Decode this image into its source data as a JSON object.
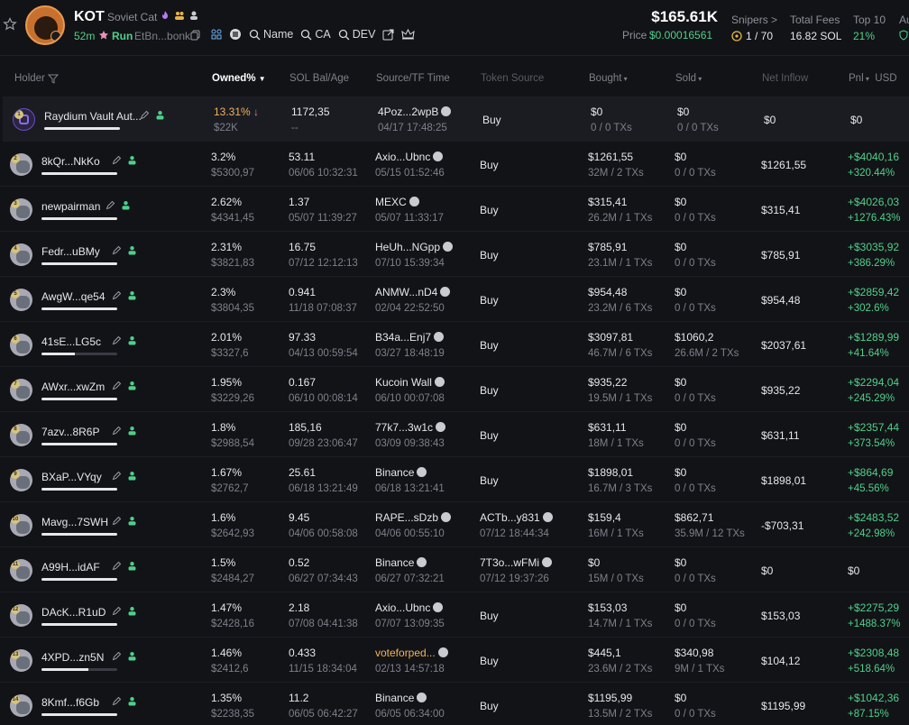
{
  "token": {
    "ticker": "KOT",
    "name": "Soviet Cat",
    "age": "52m",
    "status": "Run",
    "address": "EtBn...bonk"
  },
  "toolbar": {
    "name_label": "Name",
    "ca_label": "CA",
    "dev_label": "DEV"
  },
  "price": {
    "mcap": "$165.61K",
    "label": "Price",
    "value": "$0.00016561"
  },
  "stats": {
    "snipers_label": "Snipers >",
    "snipers_value": "1 / 70",
    "fees_label": "Total Fees",
    "fees_value": "16.82 SOL",
    "top10_label": "Top 10",
    "top10_value": "21%",
    "au_label": "Au"
  },
  "columns": {
    "holder": "Holder",
    "owned": "Owned%",
    "sol_bal": "SOL Bal/Age",
    "source": "Source/TF Time",
    "token_source": "Token Source",
    "bought": "Bought",
    "sold": "Sold",
    "net_inflow": "Net Inflow",
    "pnl": "Pnl",
    "currency": "USD"
  },
  "colors": {
    "green": "#4fd08a",
    "orange": "#f0b25a",
    "red": "#f07a8a",
    "bg": "#121317"
  },
  "rows": [
    {
      "rank": "1",
      "name": "Raydium Vault Aut...",
      "bar": 1.0,
      "owned": "13.31%",
      "owned_usd": "$22K",
      "sol": "1172,35",
      "age": "--",
      "source": "4Poz...2wpB",
      "source_time": "04/17 17:48:25",
      "tsrc": "Buy",
      "tsrc_time": "",
      "bought": "$0",
      "bought_tx": "0 / 0 TXs",
      "sold": "$0",
      "sold_tx": "0 / 0 TXs",
      "net": "$0",
      "pnl": "$0",
      "pnl_pct": ""
    },
    {
      "rank": "2",
      "name": "8kQr...NkKo",
      "bar": 1.0,
      "owned": "3.2%",
      "owned_usd": "$5300,97",
      "sol": "53.11",
      "age": "06/06 10:32:31",
      "source": "Axio...Ubnc",
      "source_time": "05/15 01:52:46",
      "tsrc": "Buy",
      "tsrc_time": "",
      "bought": "$1261,55",
      "bought_tx": "32M / 2 TXs",
      "sold": "$0",
      "sold_tx": "0 / 0 TXs",
      "net": "$1261,55",
      "pnl": "+$4040,16",
      "pnl_pct": "+320.44%"
    },
    {
      "rank": "3",
      "name": "newpairman",
      "bar": 1.0,
      "owned": "2.62%",
      "owned_usd": "$4341,45",
      "sol": "1.37",
      "age": "05/07 11:39:27",
      "source": "MEXC",
      "source_time": "05/07 11:33:17",
      "tsrc": "Buy",
      "tsrc_time": "",
      "bought": "$315,41",
      "bought_tx": "26.2M / 1 TXs",
      "sold": "$0",
      "sold_tx": "0 / 0 TXs",
      "net": "$315,41",
      "pnl": "+$4026,03",
      "pnl_pct": "+1276.43%"
    },
    {
      "rank": "4",
      "name": "Fedr...uBMy",
      "bar": 1.0,
      "owned": "2.31%",
      "owned_usd": "$3821,83",
      "sol": "16.75",
      "age": "07/12 12:12:13",
      "source": "HeUh...NGpp",
      "source_time": "07/10 15:39:34",
      "tsrc": "Buy",
      "tsrc_time": "",
      "bought": "$785,91",
      "bought_tx": "23.1M / 1 TXs",
      "sold": "$0",
      "sold_tx": "0 / 0 TXs",
      "net": "$785,91",
      "pnl": "+$3035,92",
      "pnl_pct": "+386.29%"
    },
    {
      "rank": "5",
      "name": "AwgW...qe54",
      "bar": 1.0,
      "owned": "2.3%",
      "owned_usd": "$3804,35",
      "sol": "0.941",
      "age": "11/18 07:08:37",
      "source": "ANMW...nD4",
      "source_time": "02/04 22:52:50",
      "tsrc": "Buy",
      "tsrc_time": "",
      "bought": "$954,48",
      "bought_tx": "23.2M / 6 TXs",
      "sold": "$0",
      "sold_tx": "0 / 0 TXs",
      "net": "$954,48",
      "pnl": "+$2859,42",
      "pnl_pct": "+302.6%"
    },
    {
      "rank": "6",
      "name": "41sE...LG5c",
      "bar": 0.44,
      "owned": "2.01%",
      "owned_usd": "$3327,6",
      "sol": "97.33",
      "age": "04/13 00:59:54",
      "source": "B34a...Enj7",
      "source_time": "03/27 18:48:19",
      "tsrc": "Buy",
      "tsrc_time": "",
      "bought": "$3097,81",
      "bought_tx": "46.7M / 6 TXs",
      "sold": "$1060,2",
      "sold_tx": "26.6M / 2 TXs",
      "net": "$2037,61",
      "pnl": "+$1289,99",
      "pnl_pct": "+41.64%"
    },
    {
      "rank": "7",
      "name": "AWxr...xwZm",
      "bar": 1.0,
      "owned": "1.95%",
      "owned_usd": "$3229,26",
      "sol": "0.167",
      "age": "06/10 00:08:14",
      "source": "Kucoin Wall",
      "source_time": "06/10 00:07:08",
      "tsrc": "Buy",
      "tsrc_time": "",
      "bought": "$935,22",
      "bought_tx": "19.5M / 1 TXs",
      "sold": "$0",
      "sold_tx": "0 / 0 TXs",
      "net": "$935,22",
      "pnl": "+$2294,04",
      "pnl_pct": "+245.29%"
    },
    {
      "rank": "8",
      "name": "7azv...8R6P",
      "bar": 1.0,
      "owned": "1.8%",
      "owned_usd": "$2988,54",
      "sol": "185,16",
      "age": "09/28 23:06:47",
      "source": "77k7...3w1c",
      "source_time": "03/09 09:38:43",
      "tsrc": "Buy",
      "tsrc_time": "",
      "bought": "$631,11",
      "bought_tx": "18M / 1 TXs",
      "sold": "$0",
      "sold_tx": "0 / 0 TXs",
      "net": "$631,11",
      "pnl": "+$2357,44",
      "pnl_pct": "+373.54%"
    },
    {
      "rank": "9",
      "name": "BXaP...VYqy",
      "bar": 1.0,
      "owned": "1.67%",
      "owned_usd": "$2762,7",
      "sol": "25.61",
      "age": "06/18 13:21:49",
      "source": "Binance",
      "source_time": "06/18 13:21:41",
      "tsrc": "Buy",
      "tsrc_time": "",
      "bought": "$1898,01",
      "bought_tx": "16.7M / 3 TXs",
      "sold": "$0",
      "sold_tx": "0 / 0 TXs",
      "net": "$1898,01",
      "pnl": "+$864,69",
      "pnl_pct": "+45.56%"
    },
    {
      "rank": "10",
      "name": "Mavg...7SWH",
      "bar": 1.0,
      "owned": "1.6%",
      "owned_usd": "$2642,93",
      "sol": "9.45",
      "age": "04/06 00:58:08",
      "source": "RAPE...sDzb",
      "source_time": "04/06 00:55:10",
      "tsrc": "ACTb...y831",
      "tsrc_time": "07/12 18:44:34",
      "bought": "$159,4",
      "bought_tx": "16M / 1 TXs",
      "sold": "$862,71",
      "sold_tx": "35.9M / 12 TXs",
      "net": "-$703,31",
      "pnl": "+$2483,52",
      "pnl_pct": "+242.98%"
    },
    {
      "rank": "11",
      "name": "A99H...idAF",
      "bar": 1.0,
      "owned": "1.5%",
      "owned_usd": "$2484,27",
      "sol": "0.52",
      "age": "06/27 07:34:43",
      "source": "Binance",
      "source_time": "06/27 07:32:21",
      "tsrc": "7T3o...wFMi",
      "tsrc_time": "07/12 19:37:26",
      "bought": "$0",
      "bought_tx": "15M / 0 TXs",
      "sold": "$0",
      "sold_tx": "0 / 0 TXs",
      "net": "$0",
      "pnl": "$0",
      "pnl_pct": ""
    },
    {
      "rank": "12",
      "name": "DAcK...R1uD",
      "bar": 1.0,
      "owned": "1.47%",
      "owned_usd": "$2428,16",
      "sol": "2.18",
      "age": "07/08 04:41:38",
      "source": "Axio...Ubnc",
      "source_time": "07/07 13:09:35",
      "tsrc": "Buy",
      "tsrc_time": "",
      "bought": "$153,03",
      "bought_tx": "14.7M / 1 TXs",
      "sold": "$0",
      "sold_tx": "0 / 0 TXs",
      "net": "$153,03",
      "pnl": "+$2275,29",
      "pnl_pct": "+1488.37%"
    },
    {
      "rank": "13",
      "name": "4XPD...zn5N",
      "bar": 0.62,
      "owned": "1.46%",
      "owned_usd": "$2412,6",
      "sol": "0.433",
      "age": "11/15 18:34:04",
      "source": "voteforped...",
      "source_time": "02/13 14:57:18",
      "tsrc": "Buy",
      "tsrc_time": "",
      "bought": "$445,1",
      "bought_tx": "23.6M / 2 TXs",
      "sold": "$340,98",
      "sold_tx": "9M / 1 TXs",
      "net": "$104,12",
      "pnl": "+$2308,48",
      "pnl_pct": "+518.64%"
    },
    {
      "rank": "14",
      "name": "8Kmf...f6Gb",
      "bar": 1.0,
      "owned": "1.35%",
      "owned_usd": "$2238,35",
      "sol": "11.2",
      "age": "06/05 06:42:27",
      "source": "Binance",
      "source_time": "06/05 06:34:00",
      "tsrc": "Buy",
      "tsrc_time": "",
      "bought": "$1195,99",
      "bought_tx": "13.5M / 2 TXs",
      "sold": "$0",
      "sold_tx": "0 / 0 TXs",
      "net": "$1195,99",
      "pnl": "+$1042,36",
      "pnl_pct": "+87.15%"
    }
  ]
}
